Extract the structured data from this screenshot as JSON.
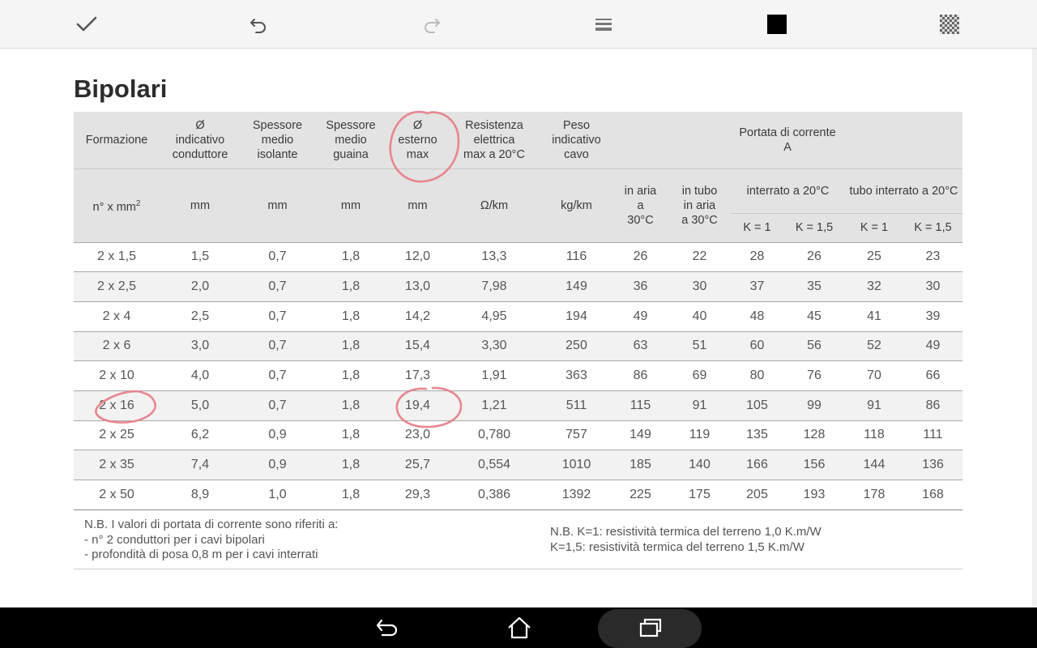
{
  "toolbar": {
    "tools": [
      "confirm-icon",
      "undo-icon",
      "redo-icon",
      "line-thickness-icon",
      "color-swatch-icon",
      "transparency-icon"
    ],
    "swatch_color": "#000000"
  },
  "document": {
    "title": "Bipolari",
    "header": {
      "formazione": "Formazione",
      "d_cond": [
        "Ø",
        "indicativo",
        "conduttore"
      ],
      "spess_iso": [
        "Spessore",
        "medio",
        "isolante"
      ],
      "spess_guaina": [
        "Spessore",
        "medio",
        "guaina"
      ],
      "d_est": [
        "Ø",
        "esterno",
        "max"
      ],
      "resistenza": [
        "Resistenza",
        "elettrica",
        "max a 20°C"
      ],
      "peso": [
        "Peso",
        "indicativo",
        "cavo"
      ],
      "portata": [
        "Portata di corrente",
        "A"
      ]
    },
    "units": {
      "formazione": "n° x mm",
      "formazione_sup": "2",
      "d_cond": "mm",
      "spess_iso": "mm",
      "spess_guaina": "mm",
      "d_est": "mm",
      "resistenza": "Ω/km",
      "peso": "kg/km"
    },
    "portata_groups": {
      "aria": [
        "in aria",
        "a",
        "30°C"
      ],
      "tubo_aria": [
        "in tubo",
        "in aria",
        "a 30°C"
      ],
      "interrato": "interrato a 20°C",
      "tubo_interrato": "tubo interrato a 20°C"
    },
    "k_labels": [
      "K = 1",
      "K = 1,5",
      "K = 1",
      "K = 1,5"
    ],
    "rows": [
      [
        "2 x 1,5",
        "1,5",
        "0,7",
        "1,8",
        "12,0",
        "13,3",
        "116",
        "26",
        "22",
        "28",
        "26",
        "25",
        "23"
      ],
      [
        "2 x 2,5",
        "2,0",
        "0,7",
        "1,8",
        "13,0",
        "7,98",
        "149",
        "36",
        "30",
        "37",
        "35",
        "32",
        "30"
      ],
      [
        "2 x 4",
        "2,5",
        "0,7",
        "1,8",
        "14,2",
        "4,95",
        "194",
        "49",
        "40",
        "48",
        "45",
        "41",
        "39"
      ],
      [
        "2 x 6",
        "3,0",
        "0,7",
        "1,8",
        "15,4",
        "3,30",
        "250",
        "63",
        "51",
        "60",
        "56",
        "52",
        "49"
      ],
      [
        "2 x 10",
        "4,0",
        "0,7",
        "1,8",
        "17,3",
        "1,91",
        "363",
        "86",
        "69",
        "80",
        "76",
        "70",
        "66"
      ],
      [
        "2 x 16",
        "5,0",
        "0,7",
        "1,8",
        "19,4",
        "1,21",
        "511",
        "115",
        "91",
        "105",
        "99",
        "91",
        "86"
      ],
      [
        "2 x 25",
        "6,2",
        "0,9",
        "1,8",
        "23,0",
        "0,780",
        "757",
        "149",
        "119",
        "135",
        "128",
        "118",
        "111"
      ],
      [
        "2 x 35",
        "7,4",
        "0,9",
        "1,8",
        "25,7",
        "0,554",
        "1010",
        "185",
        "140",
        "166",
        "156",
        "144",
        "136"
      ],
      [
        "2 x 50",
        "8,9",
        "1,0",
        "1,8",
        "29,3",
        "0,386",
        "1392",
        "225",
        "175",
        "205",
        "193",
        "178",
        "168"
      ]
    ],
    "notes_left": [
      "N.B. I valori di portata di corrente sono riferiti a:",
      "- n° 2 conduttori per i cavi bipolari",
      "- profondità di posa 0,8 m per i cavi interrati"
    ],
    "notes_right": [
      "N.B. K=1: resistività termica del terreno 1,0 K.m/W",
      "K=1,5: resistività termica del terreno 1,5 K.m/W"
    ]
  },
  "ink_color": "#e8868e",
  "navbar": {
    "buttons": [
      "back-icon",
      "home-icon",
      "recent-apps-icon"
    ]
  }
}
